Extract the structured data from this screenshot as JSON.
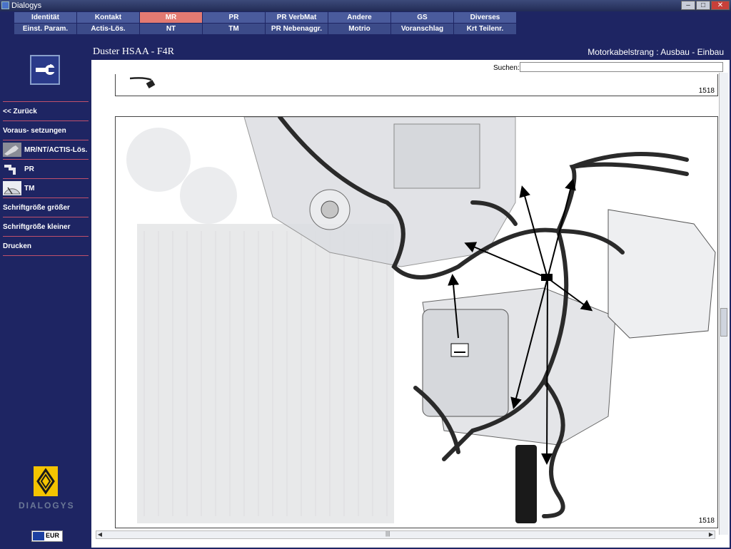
{
  "window": {
    "title": "Dialogys",
    "min": "–",
    "max": "□",
    "close": "✕"
  },
  "tabs_row1": [
    "Identität",
    "Kontakt",
    "MR",
    "PR",
    "PR VerbMat",
    "Andere",
    "GS",
    "Diverses"
  ],
  "tabs_row2": [
    "Einst. Param.",
    "Actis-Lös.",
    "NT",
    "TM",
    "PR Nebenaggr.",
    "Motrio",
    "Voranschlag",
    "Krt Teilenr."
  ],
  "active_tab": "MR",
  "colors": {
    "background": "#1e2563",
    "active_tab": "#e37a72",
    "separator": "#c0506c",
    "renault_yellow": "#f4c400"
  },
  "sidebar": {
    "items": [
      {
        "label": "<< Zurück"
      },
      {
        "label": "Voraus- setzungen"
      },
      {
        "label": "MR/NT/ACTIS-Lös.",
        "icon": "wrench-icon"
      },
      {
        "label": "PR",
        "icon": "part-icon"
      },
      {
        "label": "TM",
        "icon": "clock-icon"
      },
      {
        "label": "Schriftgröße größer"
      },
      {
        "label": "Schriftgröße kleiner"
      },
      {
        "label": "Drucken"
      }
    ],
    "brand": "DIALOGYS",
    "currency": "EUR"
  },
  "header": {
    "vehicle": "Duster HSAA - F4R",
    "operation": "Motorkabelstrang : Ausbau - Einbau"
  },
  "search": {
    "label": "Suchen:",
    "value": ""
  },
  "pages": [
    {
      "number": "1518"
    },
    {
      "number": "1518"
    }
  ],
  "scrollbar": {
    "grip": "|||"
  }
}
